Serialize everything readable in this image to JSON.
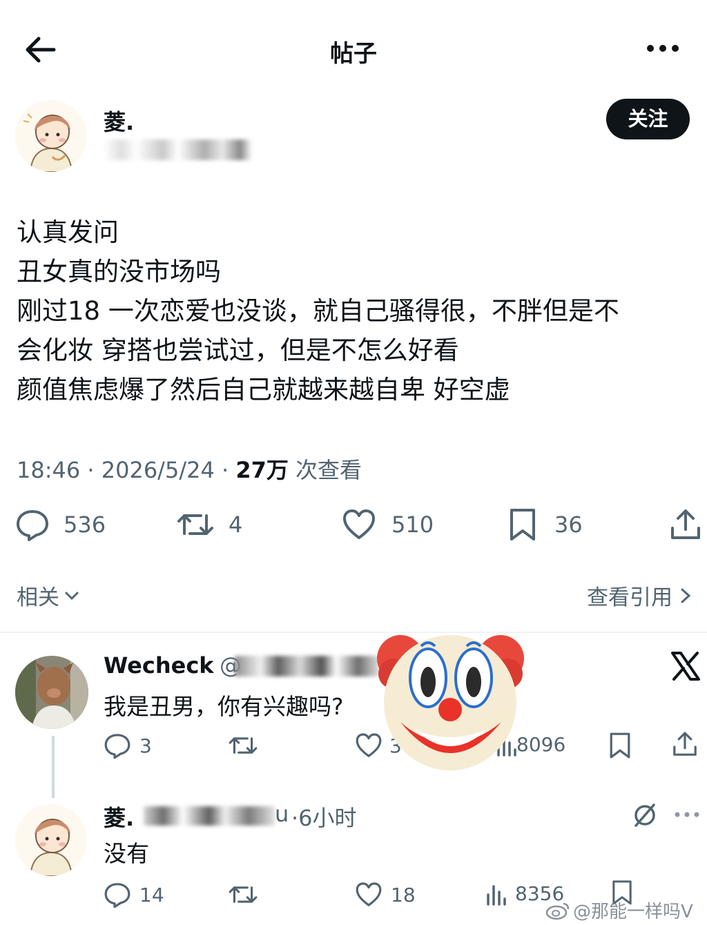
{
  "header": {
    "title": "帖子"
  },
  "post": {
    "author_name": "菱.",
    "follow_label": "关注",
    "lines": [
      "认真发问",
      "丑女真的没市场吗",
      "刚过18 一次恋爱也没谈，就自己骚得很，不胖但是不",
      "会化妆 穿搭也尝试过，但是不怎么好看",
      "颜值焦虑爆了然后自己就越来越自卑 好空虚"
    ],
    "time": "18:46",
    "date": "2026/5/24",
    "views_count": "27万",
    "views_label": "次查看",
    "sep": "·",
    "stats": {
      "replies": "536",
      "reposts": "4",
      "likes": "510",
      "bookmarks": "36"
    }
  },
  "related_label": "相关",
  "quotes_label": "查看引用",
  "replies": [
    {
      "name": "Wecheck",
      "handle_prefix": "@",
      "text": "我是丑男，你有兴趣吗?",
      "replies": "3",
      "likes_partial": "3",
      "views": "8096"
    },
    {
      "name": "菱.",
      "handle_suffix": "u",
      "time": "·6小时",
      "text": "没有",
      "replies": "14",
      "likes": "18",
      "views": "8356"
    }
  ],
  "watermark": "@那能一样吗V",
  "colors": {
    "text": "#0f1419",
    "secondary": "#536471",
    "button_bg": "#0f1419",
    "divider": "#eff3f4"
  },
  "icons": [
    "back-arrow-icon",
    "more-icon",
    "reply-icon",
    "repost-icon",
    "like-icon",
    "bookmark-icon",
    "share-icon",
    "views-icon",
    "x-logo-icon",
    "clown-emoji-icon",
    "chevron-down-icon",
    "chevron-right-icon",
    "grok-icon",
    "weibo-icon"
  ]
}
